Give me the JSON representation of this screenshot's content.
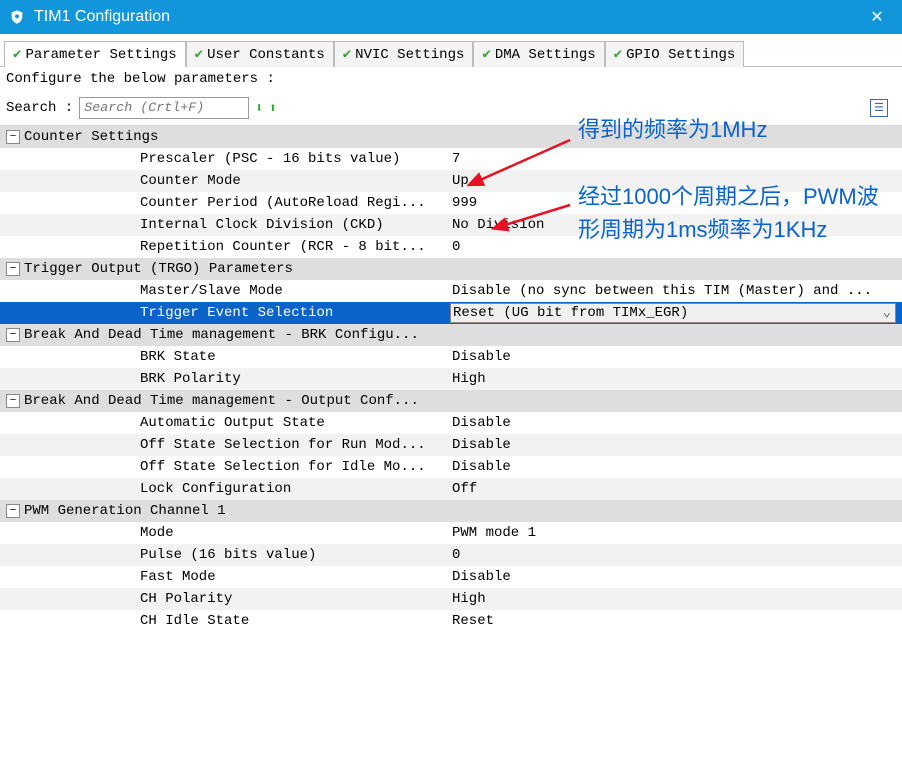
{
  "title": "TIM1 Configuration",
  "tabs": [
    {
      "label": "Parameter Settings",
      "active": true
    },
    {
      "label": "User Constants"
    },
    {
      "label": "NVIC Settings"
    },
    {
      "label": "DMA Settings"
    },
    {
      "label": "GPIO Settings"
    }
  ],
  "instruct": "Configure the below parameters :",
  "search_label": "Search :",
  "search_placeholder": "Search (Crtl+F)",
  "sections": {
    "counter": {
      "title": "Counter Settings",
      "rows": [
        {
          "k": "Prescaler (PSC - 16 bits value)",
          "v": "7"
        },
        {
          "k": "Counter Mode",
          "v": "Up"
        },
        {
          "k": "Counter Period (AutoReload Regi...",
          "v": "999"
        },
        {
          "k": "Internal Clock Division (CKD)",
          "v": "No Division"
        },
        {
          "k": "Repetition Counter (RCR - 8 bit...",
          "v": "0"
        }
      ]
    },
    "trgo": {
      "title": "Trigger Output (TRGO) Parameters",
      "rows": [
        {
          "k": "Master/Slave Mode",
          "v": "Disable (no sync between this TIM (Master) and ..."
        },
        {
          "k": "Trigger Event Selection",
          "v": "Reset (UG bit from TIMx_EGR)",
          "selected": true
        }
      ]
    },
    "brk": {
      "title": "Break And Dead Time management - BRK Configu...",
      "rows": [
        {
          "k": "BRK State",
          "v": "Disable"
        },
        {
          "k": "BRK Polarity",
          "v": "High"
        }
      ]
    },
    "out": {
      "title": "Break And Dead Time management - Output Conf...",
      "rows": [
        {
          "k": "Automatic Output State",
          "v": "Disable"
        },
        {
          "k": "Off State Selection for Run Mod...",
          "v": "Disable"
        },
        {
          "k": "Off State Selection for Idle Mo...",
          "v": "Disable"
        },
        {
          "k": "Lock Configuration",
          "v": "Off"
        }
      ]
    },
    "pwm": {
      "title": "PWM Generation Channel 1",
      "rows": [
        {
          "k": "Mode",
          "v": "PWM mode 1"
        },
        {
          "k": "Pulse (16 bits value)",
          "v": "0"
        },
        {
          "k": "Fast Mode",
          "v": "Disable"
        },
        {
          "k": "CH Polarity",
          "v": "High"
        },
        {
          "k": "CH Idle State",
          "v": "Reset"
        }
      ]
    }
  },
  "annotations": {
    "a1": "得到的频率为1MHz",
    "a2": "经过1000个周期之后，PWM波形周期为1ms频率为1KHz"
  }
}
